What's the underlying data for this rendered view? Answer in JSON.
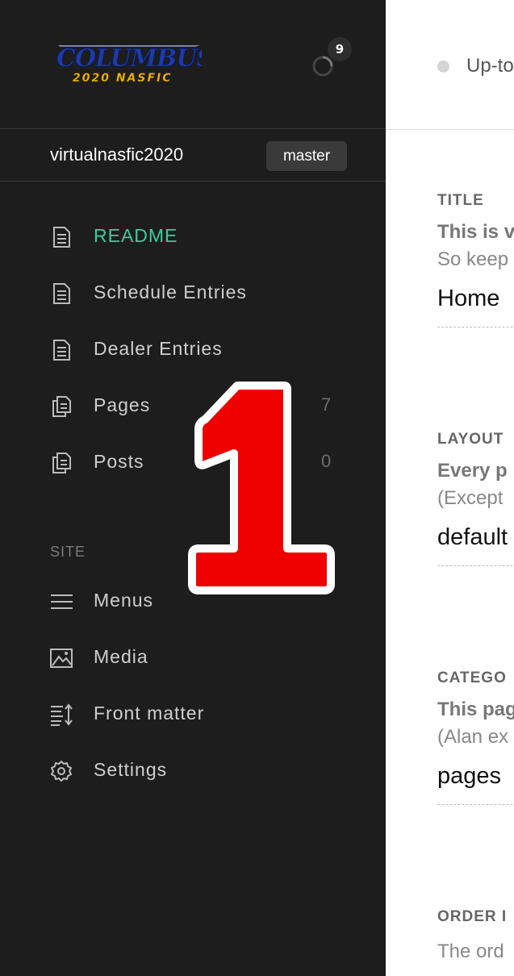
{
  "header": {
    "logo": {
      "line1": "COLUMBUS",
      "line2": "2020 NASFIC"
    },
    "notification_count": "9"
  },
  "repo": {
    "name": "virtualnasfic2020",
    "branch": "master"
  },
  "nav": {
    "items": [
      {
        "label": "README",
        "icon": "document-icon",
        "active": true
      },
      {
        "label": "Schedule Entries",
        "icon": "document-icon"
      },
      {
        "label": "Dealer Entries",
        "icon": "document-icon"
      },
      {
        "label": "Pages",
        "icon": "documents-icon",
        "count": "7"
      },
      {
        "label": "Posts",
        "icon": "documents-icon",
        "count": "0"
      }
    ],
    "site_section_label": "SITE",
    "site_items": [
      {
        "label": "Menus",
        "icon": "menu-icon"
      },
      {
        "label": "Media",
        "icon": "image-icon"
      },
      {
        "label": "Front matter",
        "icon": "front-matter-icon"
      },
      {
        "label": "Settings",
        "icon": "gear-icon"
      }
    ]
  },
  "main": {
    "status_text": "Up-to",
    "fields": [
      {
        "label": "TITLE",
        "help1": "This is v",
        "help2": "So keep",
        "value": "Home"
      },
      {
        "label": "LAYOUT",
        "help1": "Every p",
        "help2": "(Except",
        "value": "default"
      },
      {
        "label": "CATEGO",
        "help1": "This pag",
        "help2": "(Alan ex",
        "value": "pages"
      },
      {
        "label": "ORDER I",
        "help2": "The ord"
      }
    ]
  },
  "overlay": {
    "number": "1"
  },
  "colors": {
    "sidebar_bg": "#1d1d1d",
    "active_accent": "#3ecb9d",
    "overlay_red": "#ee0000",
    "logo_blue": "#1f3aa8",
    "logo_gold": "#f0b400"
  }
}
